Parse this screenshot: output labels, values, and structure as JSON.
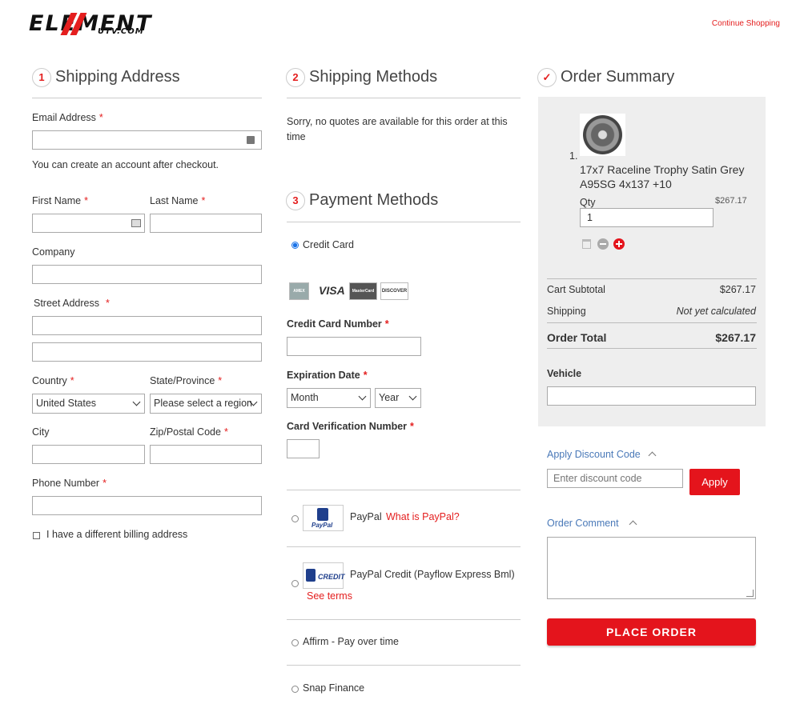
{
  "header": {
    "logo_text": "ELEMENT",
    "logo_sub": "UTV.COM",
    "continue_link": "Continue Shopping"
  },
  "shipping_address": {
    "step": "1",
    "title": "Shipping Address",
    "email_label": "Email Address",
    "email_value": "",
    "account_note": "You can create an account after checkout.",
    "first_name_label": "First Name",
    "last_name_label": "Last Name",
    "company_label": "Company",
    "street_label": "Street Address",
    "country_label": "Country",
    "country_value": "United States",
    "state_label": "State/Province",
    "state_value": "Please select a region",
    "city_label": "City",
    "zip_label": "Zip/Postal Code",
    "phone_label": "Phone Number",
    "billing_checkbox": "I have a different billing address",
    "required_mark": "*"
  },
  "shipping_methods": {
    "step": "2",
    "title": "Shipping Methods",
    "message": "Sorry, no quotes are available for this order at this time"
  },
  "payment_methods": {
    "step": "3",
    "title": "Payment Methods",
    "credit_card_label": "Credit Card",
    "card_logos": [
      "AMEX",
      "VISA",
      "MasterCard",
      "DISCOVER"
    ],
    "card_number_label": "Credit Card Number",
    "expiration_label": "Expiration Date",
    "month_value": "Month",
    "year_value": "Year",
    "cvn_label": "Card Verification Number",
    "paypal_label": "PayPal",
    "paypal_link": "What is PayPal?",
    "paypal_logo": "PayPal",
    "paypal_credit_label": "PayPal Credit (Payflow Express Bml)",
    "paypal_credit_logo": "CREDIT",
    "see_terms": "See terms",
    "affirm_label": "Affirm - Pay over time",
    "snap_label": "Snap Finance"
  },
  "order_summary": {
    "check": "✓",
    "title": "Order Summary",
    "item_index": "1.",
    "item_name": "17x7 Raceline Trophy Satin Grey A95SG 4x137 +10",
    "qty_label": "Qty",
    "qty_value": "1",
    "item_price": "$267.17",
    "subtotal_label": "Cart Subtotal",
    "subtotal_value": "$267.17",
    "shipping_label": "Shipping",
    "shipping_value": "Not yet calculated",
    "total_label": "Order Total",
    "total_value": "$267.17",
    "vehicle_label": "Vehicle"
  },
  "discount": {
    "toggle_label": "Apply Discount Code",
    "placeholder": "Enter discount code",
    "apply_label": "Apply"
  },
  "comment": {
    "toggle_label": "Order Comment"
  },
  "place_order_label": "PLACE ORDER",
  "colors": {
    "accent": "#e4141c",
    "link_blue": "#4a79b8",
    "summary_bg": "#eeeeee"
  }
}
